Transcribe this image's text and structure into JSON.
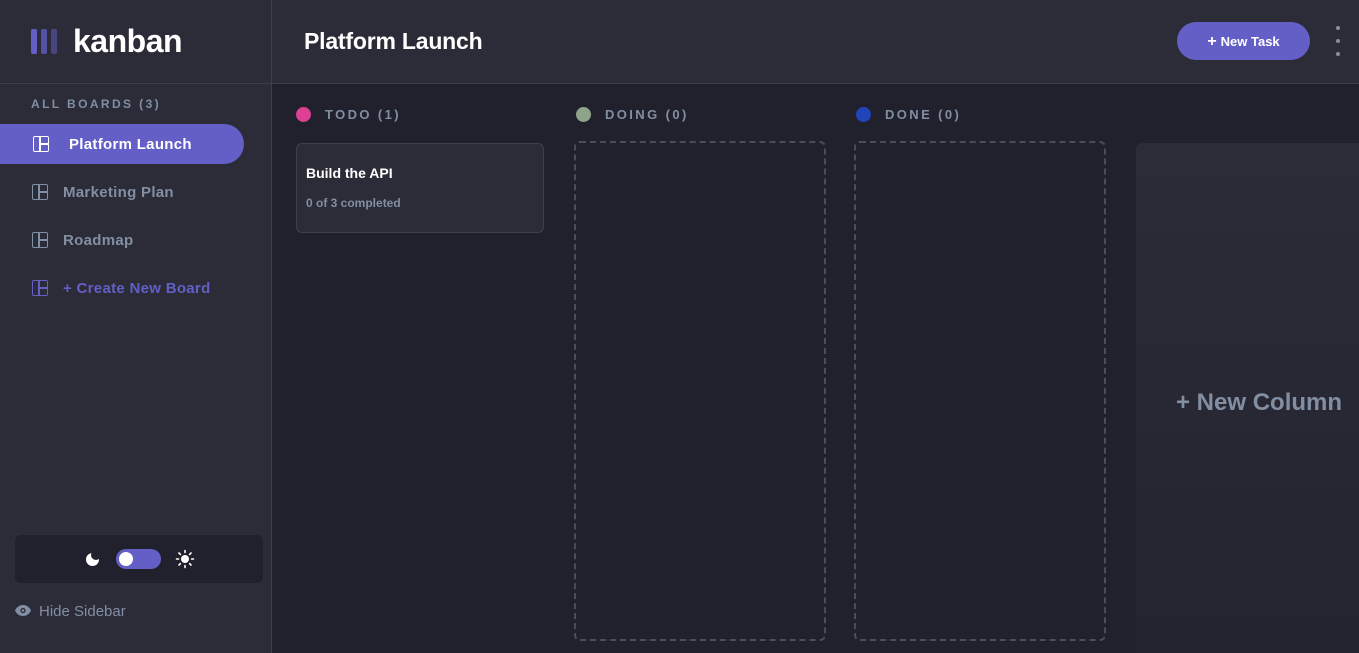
{
  "app": {
    "logo_text": "kanban"
  },
  "sidebar": {
    "boards_heading": "ALL BOARDS (3)",
    "items": [
      {
        "label": "Platform Launch",
        "active": true
      },
      {
        "label": "Marketing Plan",
        "active": false
      },
      {
        "label": "Roadmap",
        "active": false
      }
    ],
    "create_label": "+ Create New Board",
    "hide_label": "Hide Sidebar",
    "theme": {
      "dark_mode": true
    }
  },
  "header": {
    "title": "Platform Launch",
    "new_task_plus": "+",
    "new_task_label": "New Task"
  },
  "columns": [
    {
      "title": "TODO (1)",
      "color": "#dc4193"
    },
    {
      "title": "DOING (0)",
      "color": "#8fa38a"
    },
    {
      "title": "DONE (0)",
      "color": "#2144b8"
    }
  ],
  "tasks": [
    {
      "title": "Build the API",
      "subtasks": "0 of 3 completed"
    }
  ],
  "new_column_label": "+ New Column",
  "colors": {
    "accent": "#635fc7",
    "background": "#20212c",
    "surface": "#2b2c37",
    "muted_text": "#828fa3",
    "border": "#3e3f4e"
  }
}
